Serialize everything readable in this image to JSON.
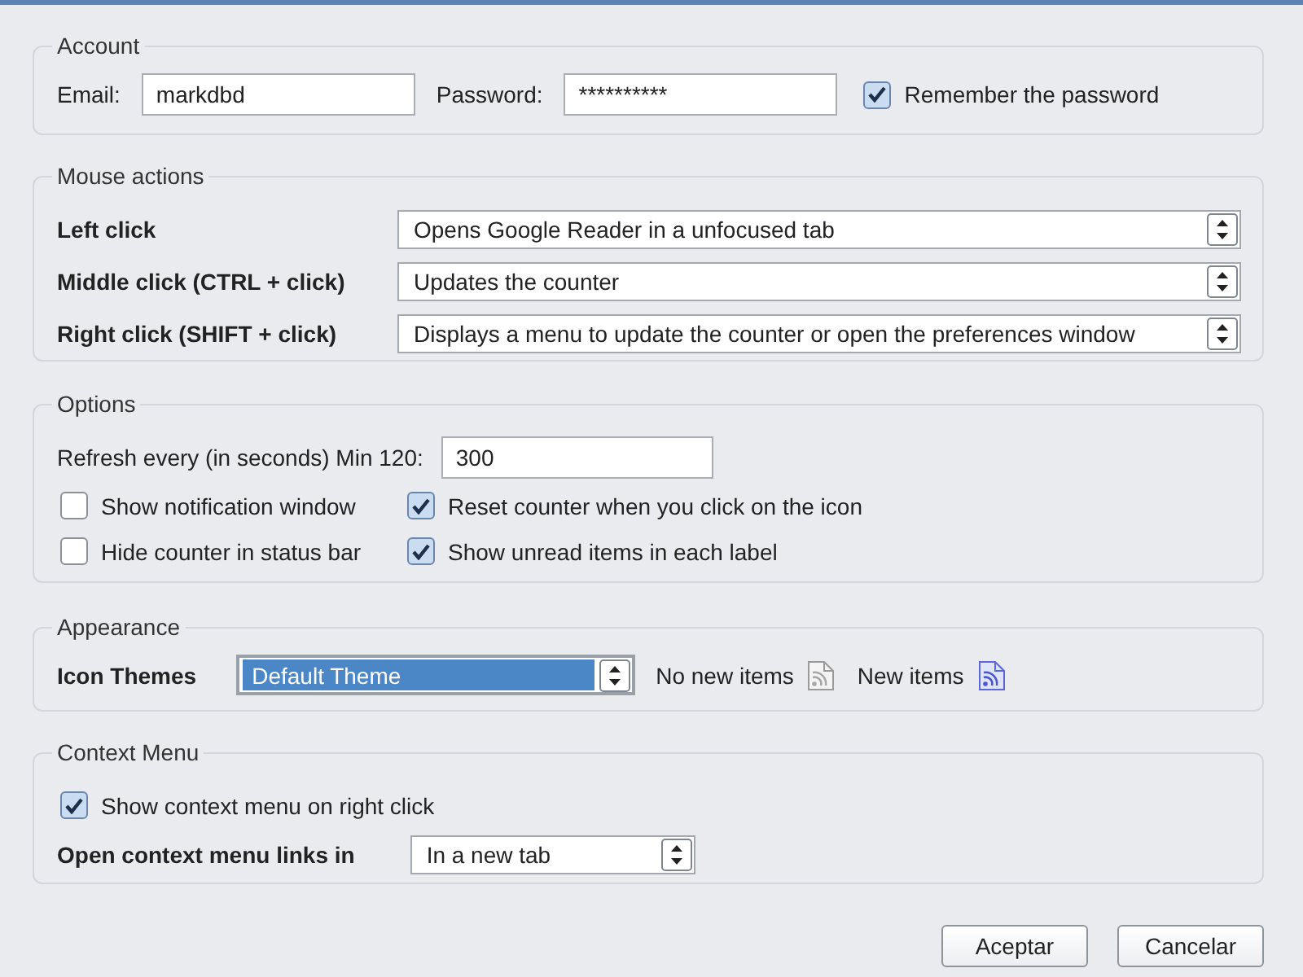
{
  "account": {
    "title": "Account",
    "email": {
      "label": "Email:",
      "value": "markdbd"
    },
    "password": {
      "label": "Password:",
      "value": "**********"
    },
    "remember": {
      "label": "Remember the password",
      "checked": true
    }
  },
  "mouse_actions": {
    "title": "Mouse actions",
    "rows": [
      {
        "label": "Left click",
        "value": "Opens Google Reader in a unfocused tab"
      },
      {
        "label": "Middle click (CTRL + click)",
        "value": "Updates the counter"
      },
      {
        "label": "Right click (SHIFT + click)",
        "value": "Displays a menu to update the counter or open the preferences window"
      }
    ]
  },
  "options": {
    "title": "Options",
    "refresh": {
      "label": "Refresh every (in seconds) Min 120:",
      "value": "300"
    },
    "checkboxes": [
      {
        "label": "Show notification window",
        "checked": false
      },
      {
        "label": "Reset counter when you click on the icon",
        "checked": true
      },
      {
        "label": "Hide counter in status bar",
        "checked": false
      },
      {
        "label": "Show unread items in each label",
        "checked": true
      }
    ]
  },
  "appearance": {
    "title": "Appearance",
    "icon_themes": {
      "label": "Icon Themes",
      "value": "Default Theme",
      "focused": true
    },
    "previews": [
      {
        "label": "No new items",
        "kind": "empty"
      },
      {
        "label": "New items",
        "kind": "new"
      }
    ]
  },
  "context_menu": {
    "title": "Context Menu",
    "show": {
      "label": "Show context menu on right click",
      "checked": true
    },
    "open_in": {
      "label": "Open context menu links in",
      "value": "In a new tab"
    }
  },
  "buttons": [
    "Aceptar",
    "Cancelar"
  ]
}
